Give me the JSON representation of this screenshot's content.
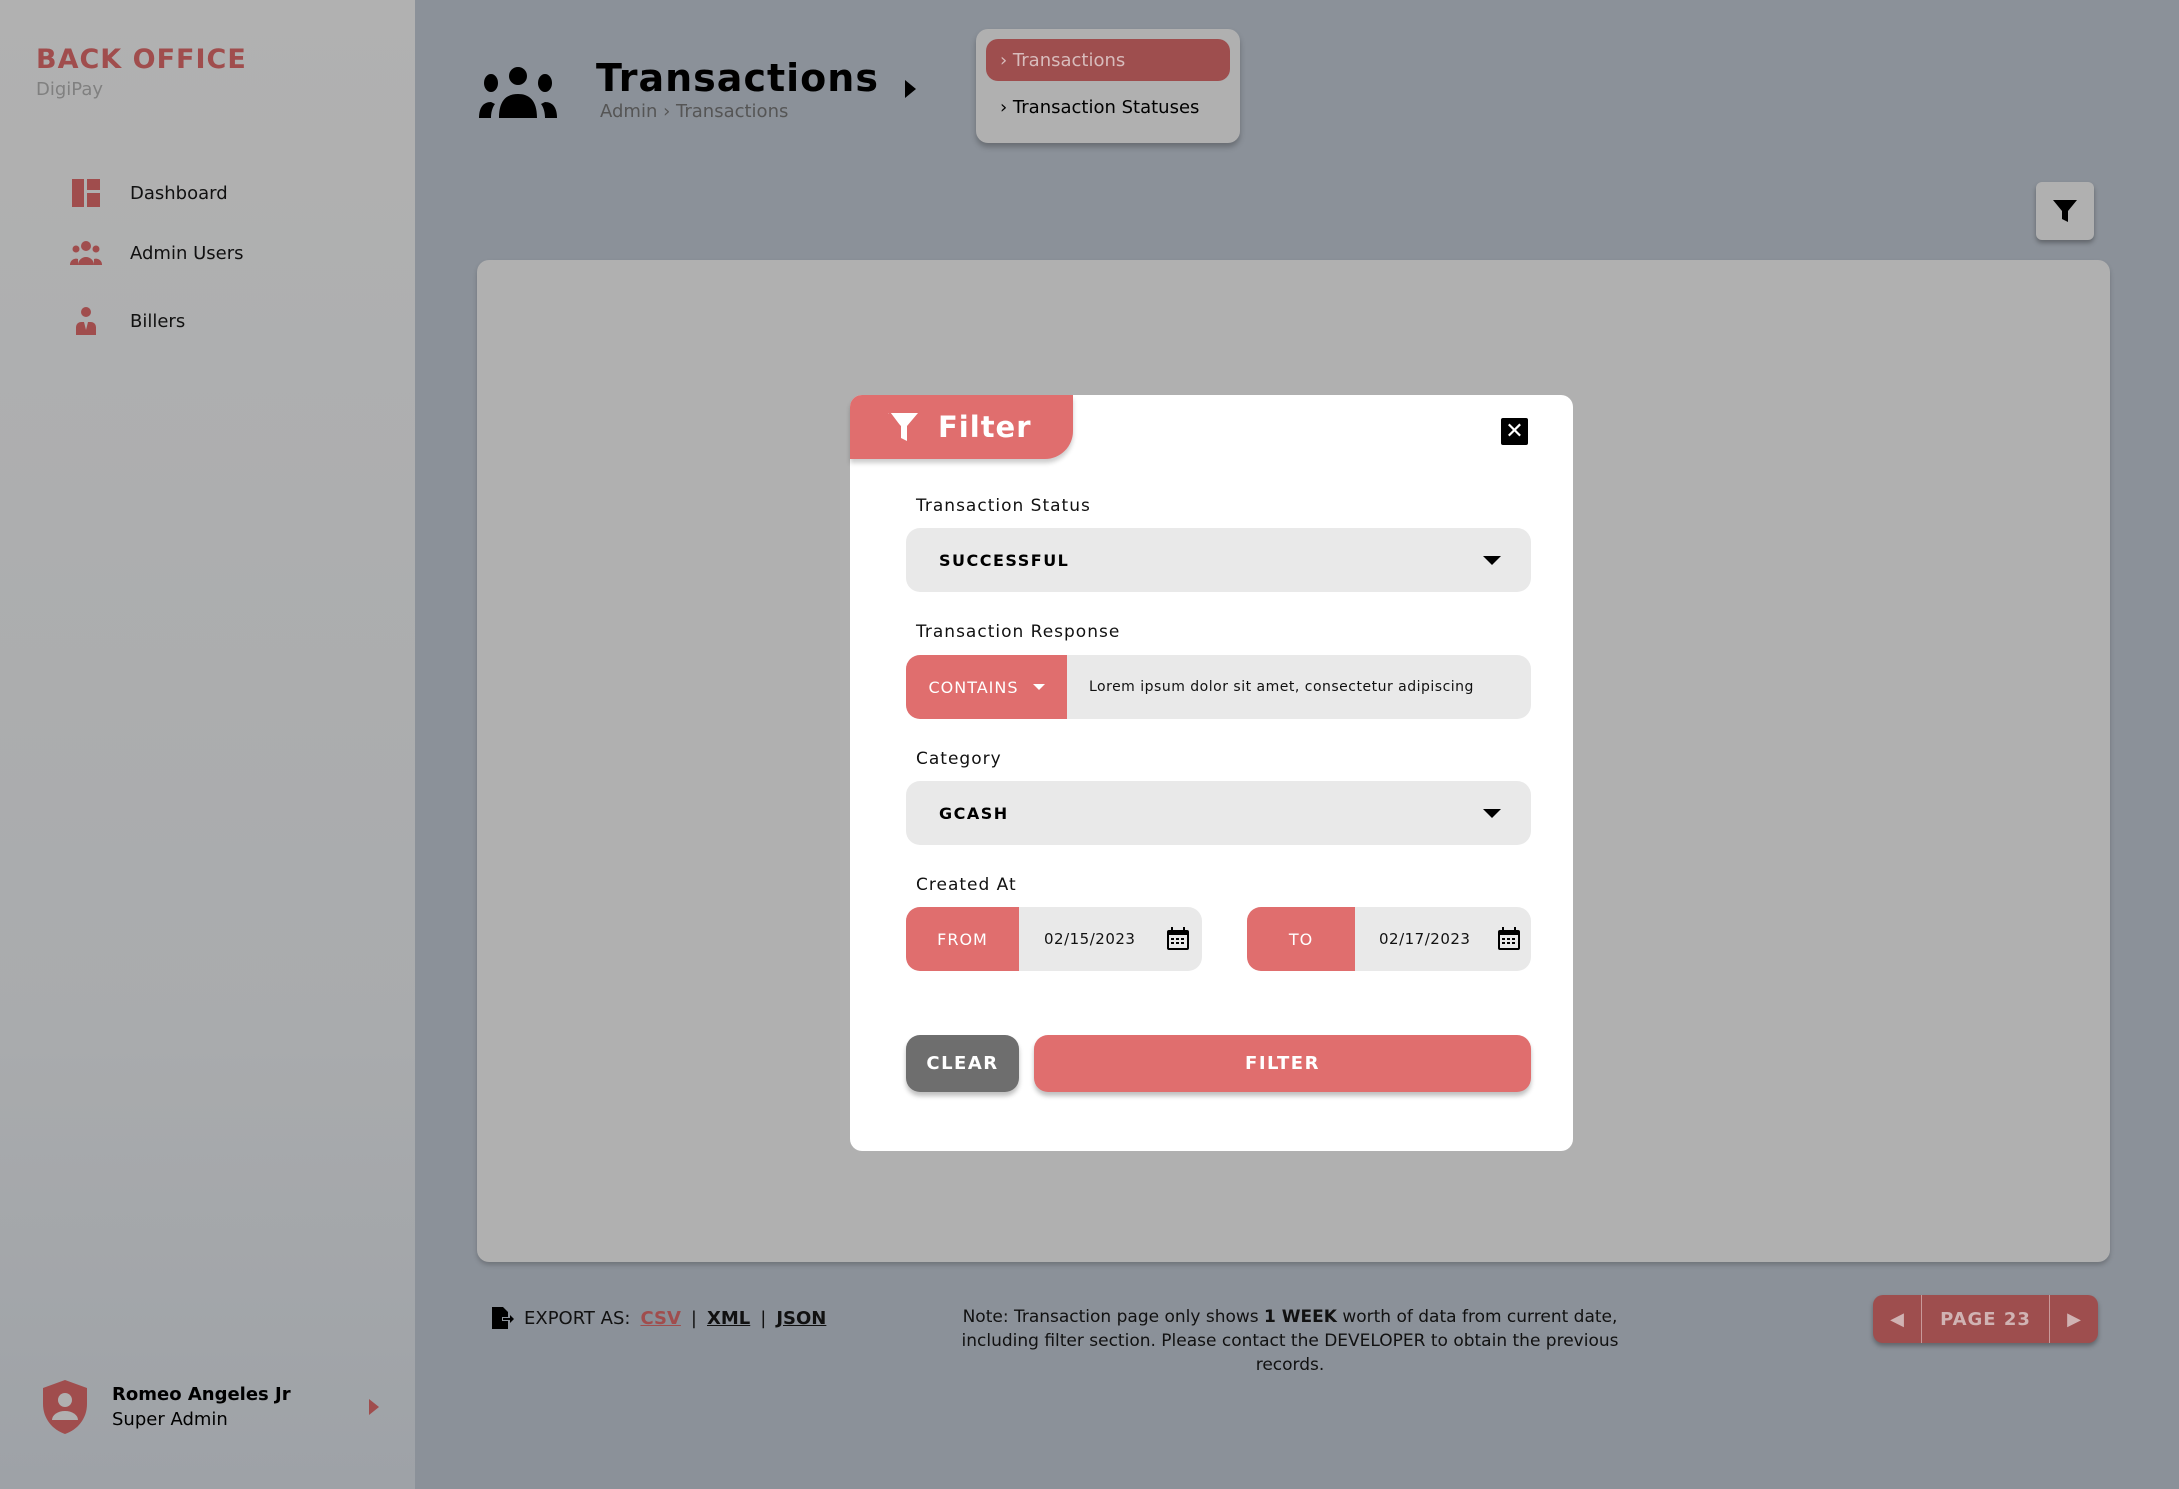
{
  "sidebar": {
    "brand": "BACK OFFICE",
    "subtitle": "DigiPay",
    "items": [
      {
        "label": "Dashboard",
        "icon": "dashboard-icon"
      },
      {
        "label": "Admin Users",
        "icon": "users-icon"
      },
      {
        "label": "Billers",
        "icon": "biller-icon"
      }
    ],
    "user": {
      "name": "Romeo Angeles Jr",
      "role": "Super Admin",
      "icon": "shield-user-icon"
    }
  },
  "header": {
    "title": "Transactions",
    "breadcrumb": "Admin › Transactions",
    "menu": [
      {
        "label": "› Transactions",
        "active": true
      },
      {
        "label": "› Transaction Statuses",
        "active": false
      }
    ]
  },
  "footer": {
    "export_label": "EXPORT AS:",
    "formats": [
      "CSV",
      "XML",
      "JSON"
    ],
    "separator": "|",
    "note_pre": "Note: Transaction page only shows ",
    "note_bold": "1 WEEK",
    "note_post": " worth of data from current date, including filter section. Please contact the DEVELOPER to obtain the previous records.",
    "page": "PAGE 23"
  },
  "filter_modal": {
    "title": "Filter",
    "status_label": "Transaction Status",
    "status_value": "SUCCESSFUL",
    "response_label": "Transaction Response",
    "response_operator": "CONTAINS",
    "response_value": "Lorem ipsum dolor sit amet, consectetur adipiscing",
    "category_label": "Category",
    "category_value": "GCASH",
    "created_label": "Created At",
    "from_label": "FROM",
    "from_value": "02/15/2023",
    "to_label": "TO",
    "to_value": "02/17/2023",
    "clear_label": "CLEAR",
    "filter_label": "FILTER"
  },
  "colors": {
    "accent": "#e06e6e",
    "accent_dimmed": "#9e4e4e",
    "clear": "#6e6e6e",
    "overlay_bg": "#8b9199"
  }
}
